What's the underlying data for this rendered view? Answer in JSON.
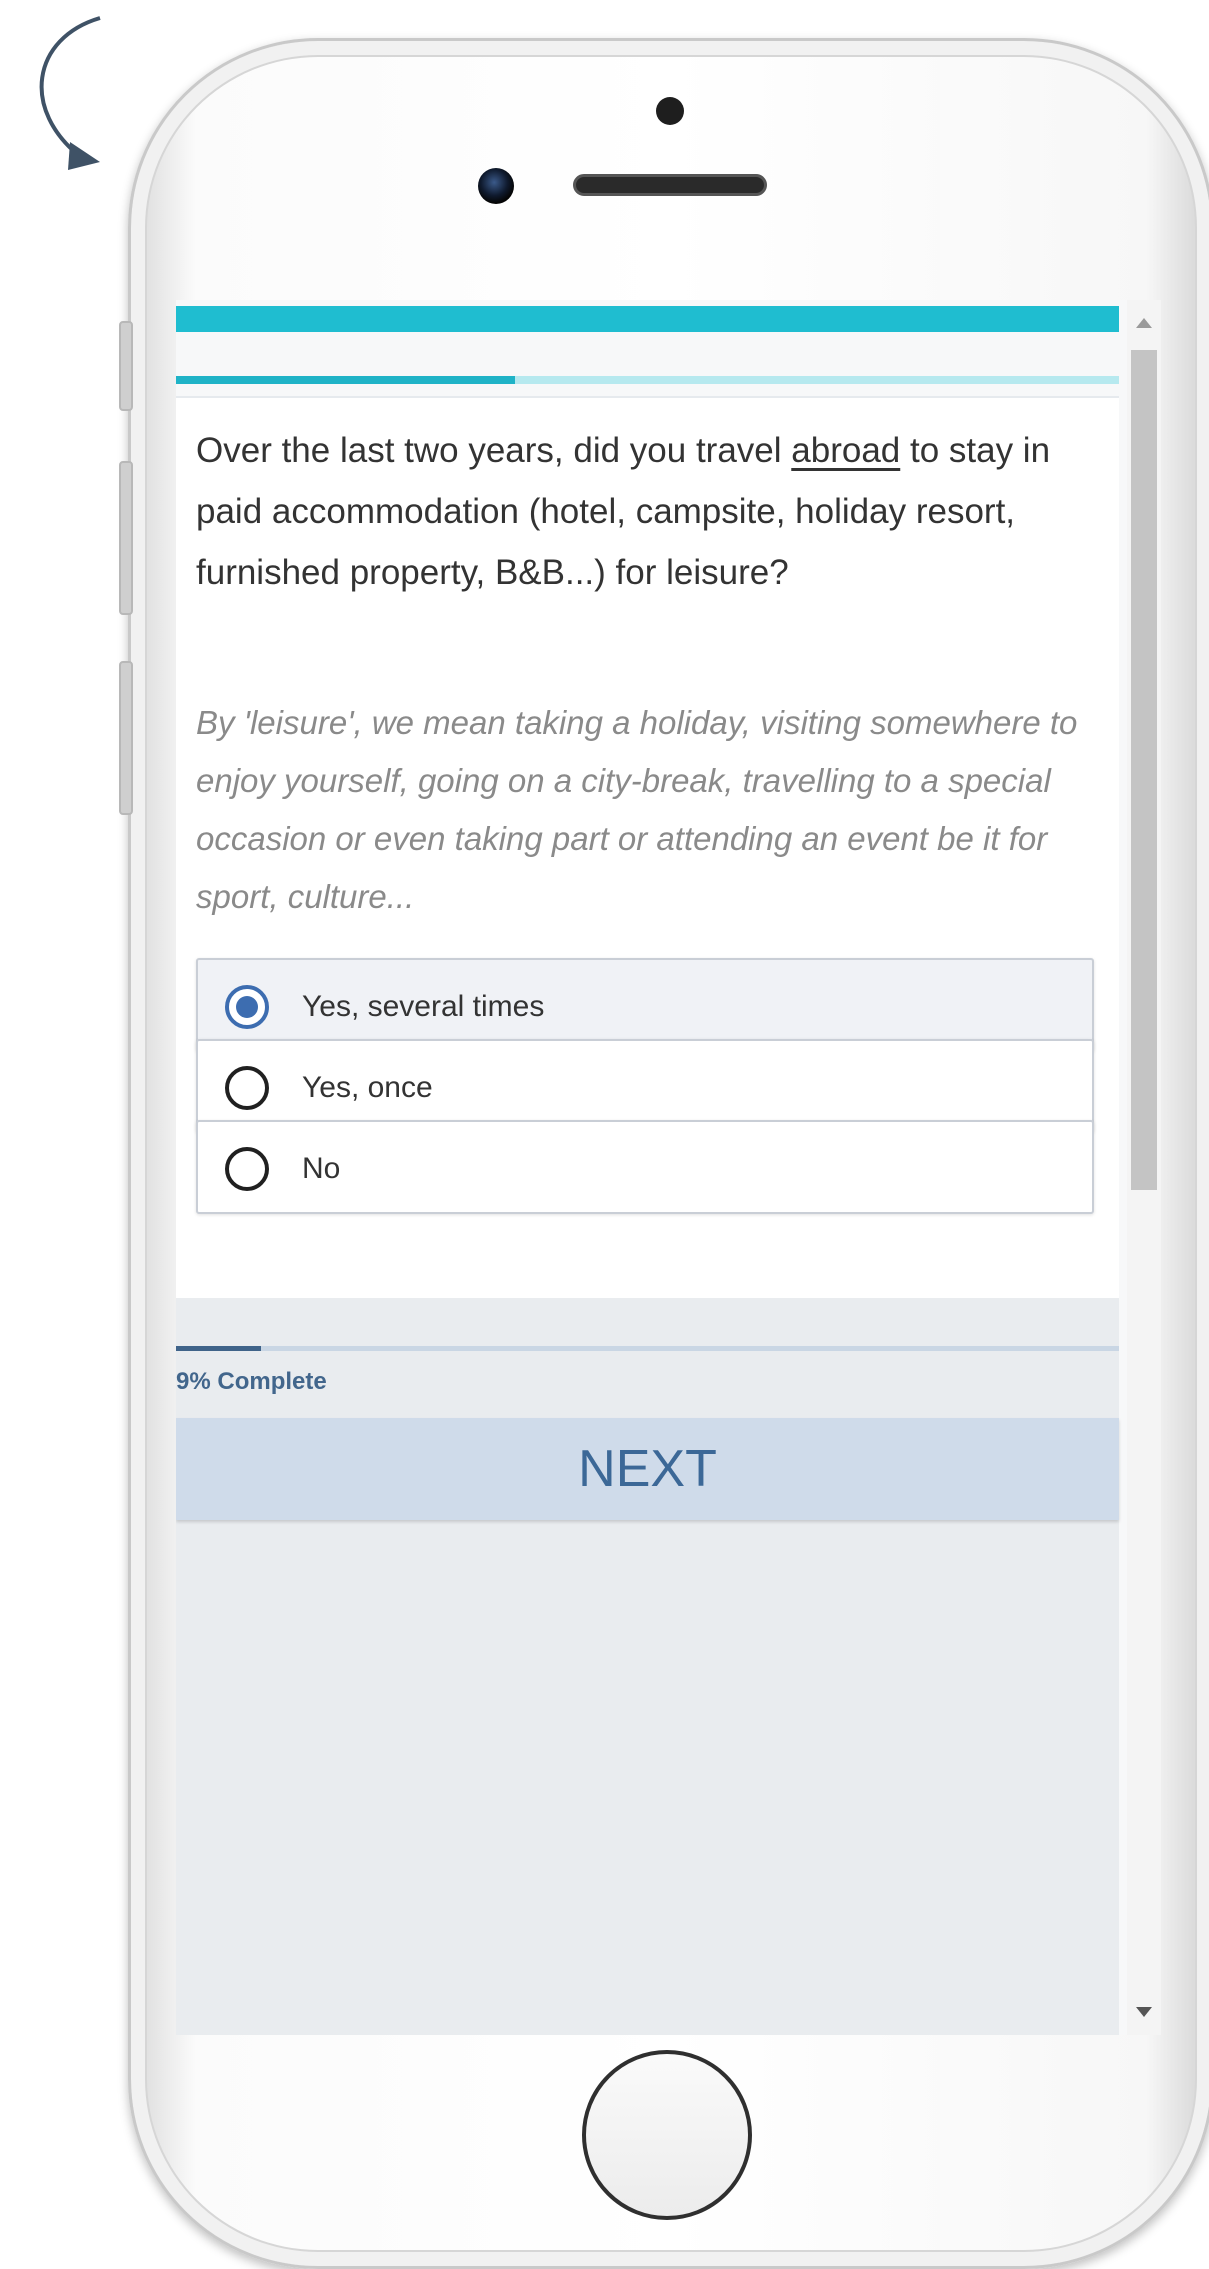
{
  "survey": {
    "question_before": "Over the last two years, did you travel ",
    "question_emphasis": "abroad",
    "question_after": " to stay in paid accommodation (hotel, campsite, holiday resort, furnished property, B&B...) for leisure?",
    "hint": "By 'leisure', we mean taking a holiday, visiting somewhere to enjoy yourself, going on a city-break, travelling to a special occasion or even taking part or attending an event be it for sport, culture...",
    "options": [
      {
        "label": "Yes, several times",
        "selected": true
      },
      {
        "label": "Yes, once",
        "selected": false
      },
      {
        "label": "No",
        "selected": false
      }
    ]
  },
  "section_progress": {
    "fraction": 0.36
  },
  "progress": {
    "percent": 9,
    "label": "9% Complete"
  },
  "actions": {
    "next_label": "NEXT"
  },
  "colors": {
    "accent_teal": "#1fbdd0",
    "primary_blue": "#3d6db0",
    "next_button_bg": "#cfdbea"
  }
}
